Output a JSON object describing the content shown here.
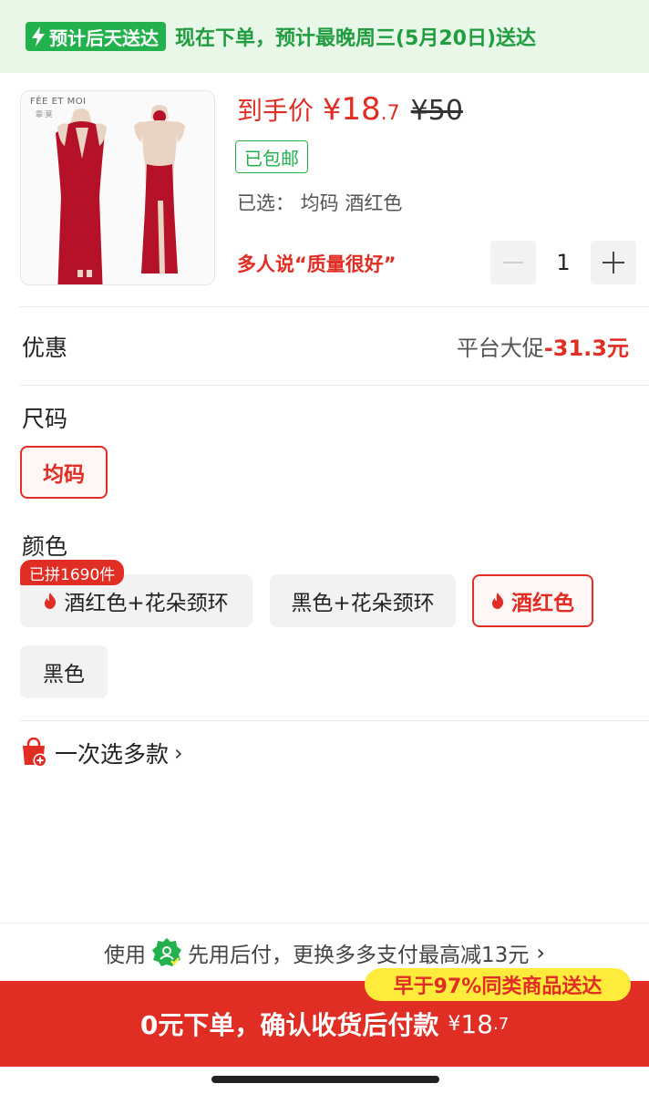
{
  "banner": {
    "fast_tag": "预计后天送达",
    "text": "现在下单，预计最晚周三(5月20日)送达",
    "color": "#22b14c"
  },
  "product": {
    "brand": "FÉE ET MOI",
    "brand_sub": "霏·莫",
    "price_label": "到手价",
    "price_symbol": "¥",
    "price_int": "18",
    "price_dec": ".7",
    "original_price": "¥50",
    "free_shipping": "已包邮",
    "selected_text": "已选：  均码  酒红色",
    "quality_text": "多人说“质量很好”",
    "quantity": "1",
    "dress_color": "#b5122a"
  },
  "discount": {
    "label": "优惠",
    "platform": "平台大促",
    "amount": "-31.3元"
  },
  "size": {
    "label": "尺码",
    "options": [
      "均码"
    ],
    "selected": "均码"
  },
  "color": {
    "label": "颜色",
    "joined_badge": "已拼1690件",
    "options": [
      "酒红色+花朵颈环",
      "黑色+花朵颈环",
      "酒红色",
      "黑色"
    ],
    "selected": "酒红色"
  },
  "multi_select": {
    "label": "一次选多款",
    "chevron": "›"
  },
  "pay": {
    "prefix": "使用",
    "text": "先用后付，更换多多支付最高减13元",
    "chevron": "›"
  },
  "order": {
    "label": "0元下单，确认收货后付款",
    "symbol": "¥",
    "amount_int": "18",
    "amount_dec": ".7",
    "early_badge": "早于97%同类商品送达"
  },
  "colors": {
    "accent": "#e02e24",
    "green": "#22b14c",
    "badge_yellow": "#ffeb3b"
  }
}
